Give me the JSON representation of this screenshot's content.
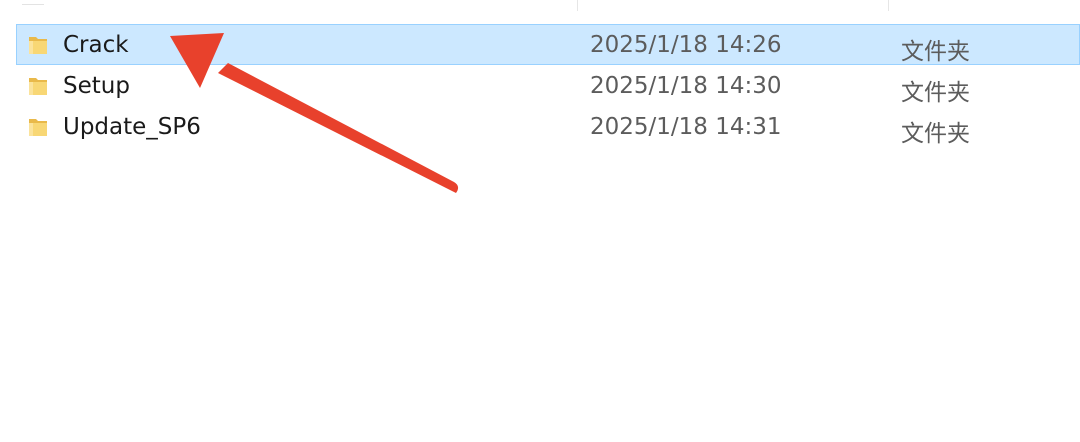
{
  "files": [
    {
      "name": "Crack",
      "modified": "2025/1/18 14:26",
      "type": "文件夹",
      "selected": true,
      "icon": "folder-icon"
    },
    {
      "name": "Setup",
      "modified": "2025/1/18 14:30",
      "type": "文件夹",
      "selected": false,
      "icon": "folder-icon"
    },
    {
      "name": "Update_SP6",
      "modified": "2025/1/18 14:31",
      "type": "文件夹",
      "selected": false,
      "icon": "folder-icon"
    }
  ],
  "colors": {
    "selection_fill": "#cce8ff",
    "selection_border": "#99d1ff",
    "folder": "#f8d775",
    "arrow": "#e8412c"
  }
}
